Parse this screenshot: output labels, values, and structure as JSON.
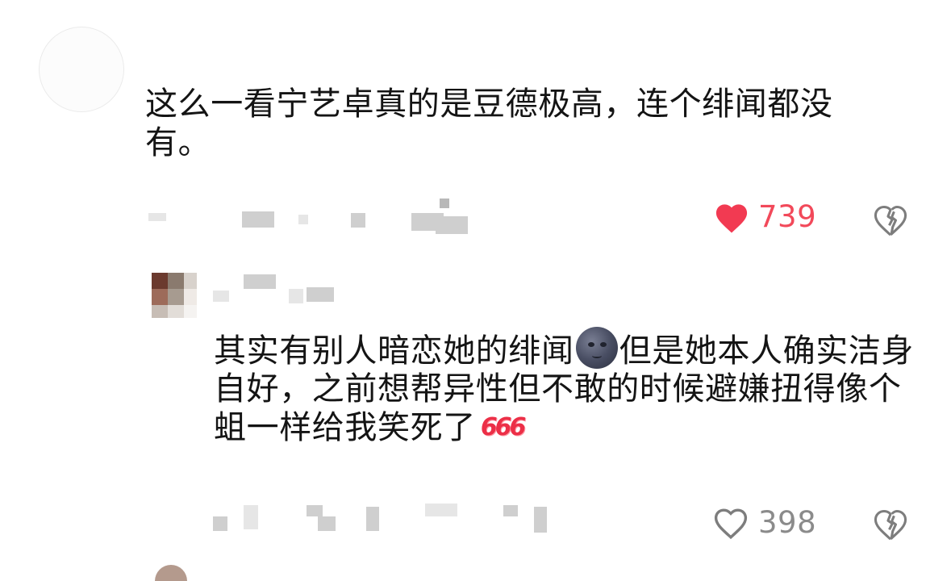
{
  "comments": [
    {
      "text": "这么一看宁艺卓真的是豆德极高，连个绯闻都没有。",
      "likes": "739",
      "liked": true
    },
    {
      "text_part1": "其实有别人暗恋她的绯闻",
      "emoji_1": "new-moon-face-emoji",
      "text_part2": "但是她本人确实洁身自好，之前想帮异性但不敢的时候避嫌扭得像个蛆一样给我笑死了",
      "emoji_2": "666",
      "likes": "398",
      "liked": false
    }
  ],
  "colors": {
    "like_active": "#f23a52",
    "like_count_active": "#f2495a",
    "like_inactive": "#8b8b8b"
  }
}
